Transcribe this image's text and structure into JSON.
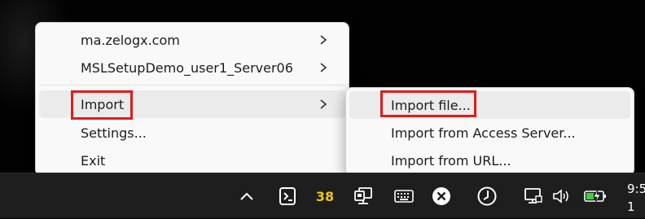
{
  "main_menu": {
    "items": [
      {
        "label": "ma.zelogx.com",
        "has_submenu": true
      },
      {
        "label": "MSLSetupDemo_user1_Server06",
        "has_submenu": true
      },
      {
        "label": "Import",
        "has_submenu": true
      },
      {
        "label": "Settings...",
        "has_submenu": false
      },
      {
        "label": "Exit",
        "has_submenu": false
      }
    ]
  },
  "import_submenu": {
    "items": [
      {
        "label": "Import file..."
      },
      {
        "label": "Import from Access Server..."
      },
      {
        "label": "Import from URL..."
      }
    ]
  },
  "taskbar": {
    "tray_icons": [
      "chevron-up-icon",
      "terminal-app-icon",
      "notification-count-badge",
      "network-vpn-icon",
      "keyboard-icon",
      "close-circle-icon",
      "timer-icon",
      "network-icon",
      "volume-icon",
      "battery-charging-icon"
    ],
    "badge_count": "38",
    "clock_time": "9:5",
    "clock_date": "1"
  },
  "colors": {
    "highlight": "#e11b1b",
    "badge": "#f0c419",
    "menu_bg": "#f9f9f9",
    "hover_bg": "#ebebeb",
    "taskbar_bg": "#1e1e1e",
    "battery_green": "#3bd13b"
  }
}
